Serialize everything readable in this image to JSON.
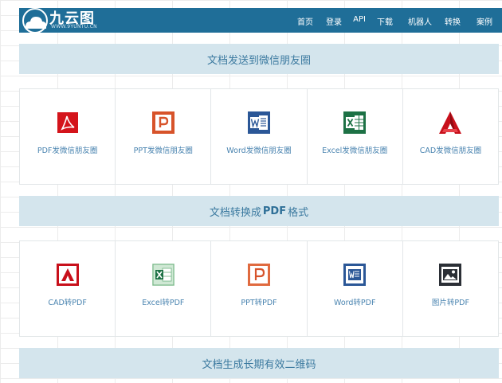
{
  "header": {
    "logo_title": "九云图",
    "logo_sub": "WWW.9YUNTU.CN",
    "nav": [
      "首页",
      "登录",
      "API",
      "下载",
      "机器人",
      "转换",
      "案例"
    ]
  },
  "sections": [
    {
      "title_parts": [
        "文档发送到微信朋友圈"
      ],
      "cards": [
        {
          "label": "PDF发微信朋友圈",
          "icon": "pdf-icon"
        },
        {
          "label": "PPT发微信朋友圈",
          "icon": "ppt-icon"
        },
        {
          "label": "Word发微信朋友圈",
          "icon": "word-icon"
        },
        {
          "label": "Excel发微信朋友圈",
          "icon": "excel-icon"
        },
        {
          "label": "CAD发微信朋友圈",
          "icon": "cad-icon"
        }
      ]
    },
    {
      "title_parts": [
        "文档转换成",
        "PDF",
        "格式"
      ],
      "cards": [
        {
          "label": "CAD转PDF",
          "icon": "cad-icon"
        },
        {
          "label": "Excel转PDF",
          "icon": "excel-icon"
        },
        {
          "label": "PPT转PDF",
          "icon": "ppt-icon"
        },
        {
          "label": "Word转PDF",
          "icon": "word-icon"
        },
        {
          "label": "图片转PDF",
          "icon": "image-icon"
        }
      ]
    },
    {
      "title_parts": [
        "文档生成长期有效二维码"
      ]
    }
  ],
  "colors": {
    "header_bg": "#1f6e98",
    "banner_bg": "#d4e5ed",
    "link_text": "#4a84b0",
    "pdf_red": "#d4141b",
    "ppt_orange": "#d7532a",
    "word_blue": "#2b5797",
    "excel_green": "#1d7145",
    "cad_red": "#c8101b"
  }
}
